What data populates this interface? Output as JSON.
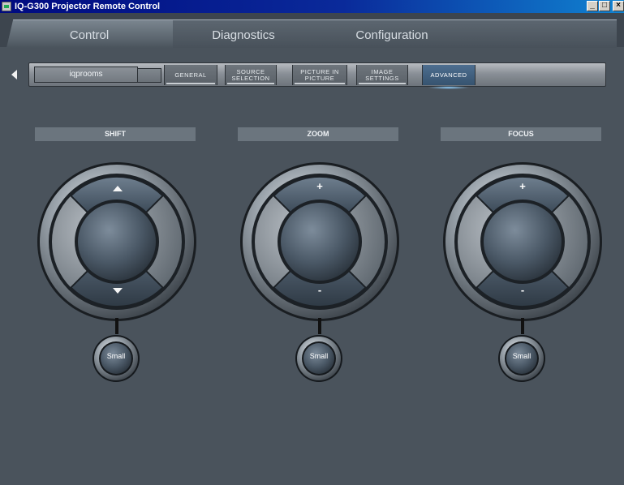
{
  "window": {
    "title": "IQ-G300 Projector Remote Control"
  },
  "tabs": [
    {
      "label": "Control",
      "active": true
    },
    {
      "label": "Diagnostics",
      "active": false
    },
    {
      "label": "Configuration",
      "active": false
    }
  ],
  "subnav": {
    "device": "iqprooms",
    "buttons": [
      {
        "label": "GENERAL",
        "active": false
      },
      {
        "label": "SOURCE SELECTION",
        "active": false
      },
      {
        "label": "PICTURE IN PICTURE",
        "active": false
      },
      {
        "label": "IMAGE SETTINGS",
        "active": false
      },
      {
        "label": "ADVANCED",
        "active": true
      }
    ]
  },
  "controls": {
    "shift": {
      "title": "SHIFT",
      "small_label": "Small"
    },
    "zoom": {
      "title": "ZOOM",
      "up_symbol": "+",
      "down_symbol": "-",
      "small_label": "Small"
    },
    "focus": {
      "title": "FOCUS",
      "up_symbol": "+",
      "down_symbol": "-",
      "small_label": "Small"
    }
  },
  "colors": {
    "background": "#4a535c",
    "active_glow": "#8fd0ff",
    "titlebar": "#0a2a9a"
  },
  "icons": {
    "back": "chevron-left-icon",
    "up": "triangle-up-icon",
    "down": "triangle-down-icon"
  }
}
